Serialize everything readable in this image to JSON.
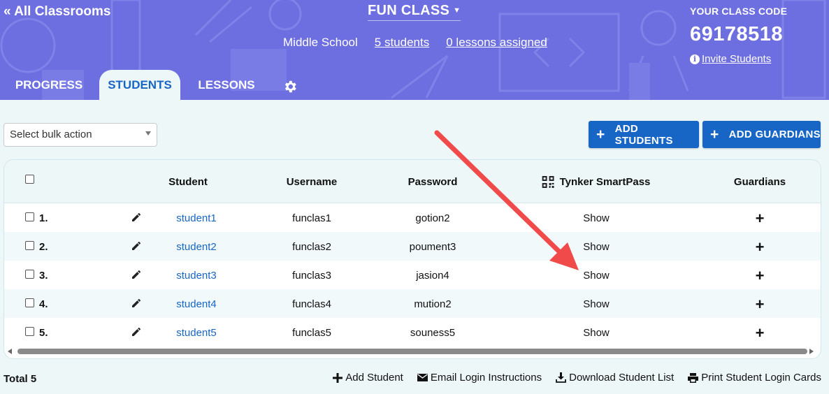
{
  "header": {
    "back_link": "« All Classrooms",
    "class_name": "FUN CLASS",
    "level": "Middle School",
    "students_link": "5 students",
    "lessons_link": "0 lessons assigned",
    "class_code_label": "YOUR CLASS CODE",
    "class_code": "69178518",
    "invite_label": "Invite Students"
  },
  "tabs": [
    {
      "label": "PROGRESS",
      "active": false
    },
    {
      "label": "STUDENTS",
      "active": true
    },
    {
      "label": "LESSONS",
      "active": false
    }
  ],
  "toolbar": {
    "bulk_action_placeholder": "Select bulk action",
    "add_students_label": "ADD STUDENTS",
    "add_guardians_label": "ADD GUARDIANS"
  },
  "table": {
    "columns": {
      "student": "Student",
      "username": "Username",
      "password": "Password",
      "smartpass": "Tynker SmartPass",
      "guardians": "Guardians"
    },
    "rows": [
      {
        "num": "1.",
        "student": "student1",
        "username": "funclas1",
        "password": "gotion2",
        "smartpass": "Show"
      },
      {
        "num": "2.",
        "student": "student2",
        "username": "funclas2",
        "password": "poument3",
        "smartpass": "Show"
      },
      {
        "num": "3.",
        "student": "student3",
        "username": "funclas3",
        "password": "jasion4",
        "smartpass": "Show"
      },
      {
        "num": "4.",
        "student": "student4",
        "username": "funclas4",
        "password": "mution2",
        "smartpass": "Show"
      },
      {
        "num": "5.",
        "student": "student5",
        "username": "funclas5",
        "password": "souness5",
        "smartpass": "Show"
      }
    ]
  },
  "footer": {
    "total": "Total 5",
    "add_student": "Add Student",
    "email_login": "Email Login Instructions",
    "download_list": "Download Student List",
    "print_cards": "Print Student Login Cards"
  },
  "colors": {
    "header_bg": "#6d6fe0",
    "accent_blue": "#1766c5",
    "annotation_arrow": "#f04a4a"
  }
}
